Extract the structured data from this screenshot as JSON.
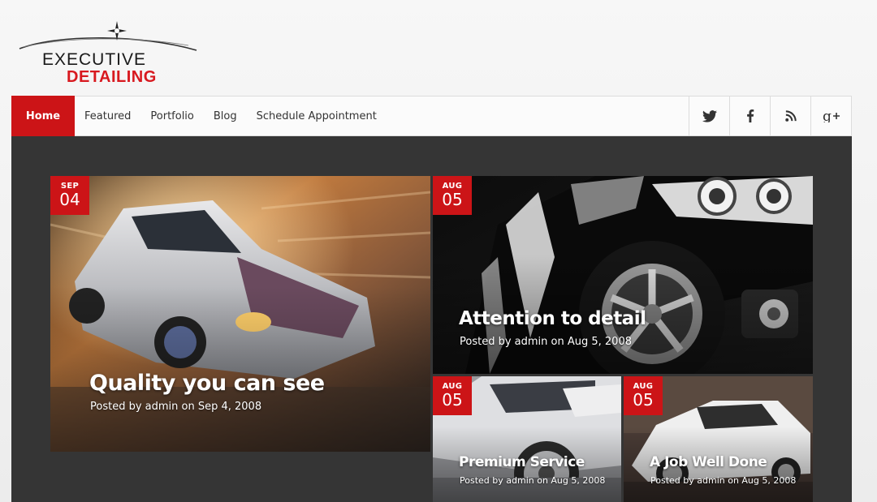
{
  "logo": {
    "line1": "EXECUTIVE",
    "line2": "DETAILING"
  },
  "nav": {
    "items": [
      {
        "label": "Home",
        "active": true
      },
      {
        "label": "Featured"
      },
      {
        "label": "Portfolio"
      },
      {
        "label": "Blog"
      },
      {
        "label": "Schedule Appointment"
      }
    ],
    "social": [
      "twitter-icon",
      "facebook-icon",
      "rss-icon",
      "google-plus-icon"
    ]
  },
  "slides": [
    {
      "month": "SEP",
      "day": "04",
      "title": "Quality you can see",
      "meta": "Posted by admin on Sep 4, 2008"
    },
    {
      "month": "AUG",
      "day": "05",
      "title": "Attention to detail",
      "meta": "Posted by admin on Aug 5, 2008"
    },
    {
      "month": "AUG",
      "day": "05",
      "title": "Premium Service",
      "meta": "Posted by admin on Aug 5, 2008"
    },
    {
      "month": "AUG",
      "day": "05",
      "title": "A Job Well Done",
      "meta": "Posted by admin on Aug 5, 2008"
    }
  ],
  "colors": {
    "accent": "#cc1417",
    "slider_background": "#353535"
  }
}
